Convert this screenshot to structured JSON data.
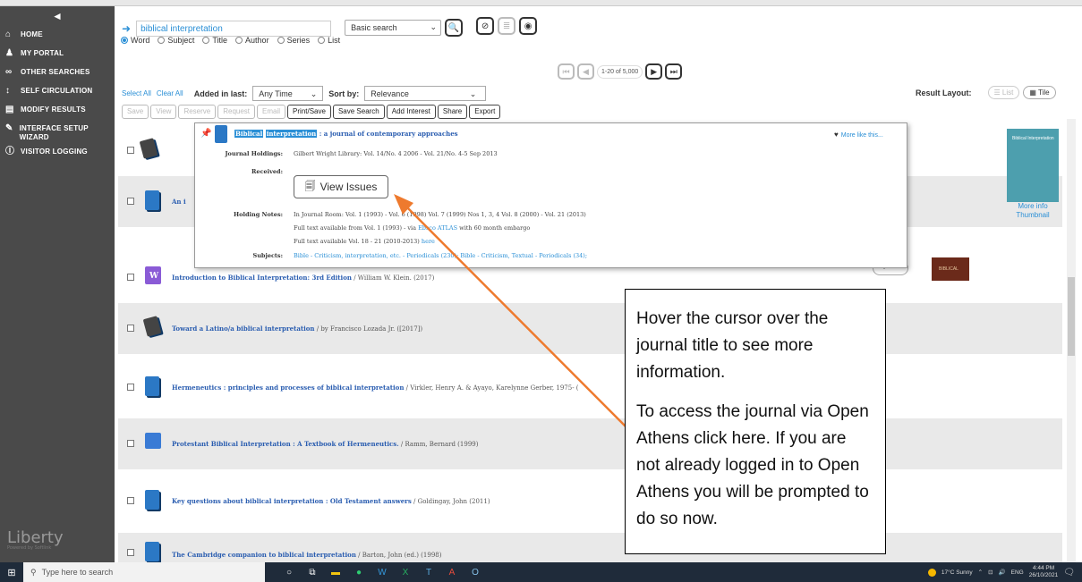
{
  "sidebar": {
    "collapse": "◄",
    "items": [
      {
        "icon": "home-icon",
        "glyph": "⌂",
        "label": "HOME"
      },
      {
        "icon": "user-icon",
        "glyph": "♟",
        "label": "MY PORTAL"
      },
      {
        "icon": "binoculars-icon",
        "glyph": "∞",
        "label": "OTHER SEARCHES"
      },
      {
        "icon": "circulation-icon",
        "glyph": "↕",
        "label": "SELF CIRCULATION"
      },
      {
        "icon": "modify-icon",
        "glyph": "▤",
        "label": "MODIFY RESULTS"
      },
      {
        "icon": "wizard-icon",
        "glyph": "✎",
        "label": "INTERFACE SETUP WIZARD"
      },
      {
        "icon": "info-icon",
        "glyph": "ⓘ",
        "label": "VISITOR LOGGING"
      }
    ],
    "logo": "Liberty",
    "logo_sub": "Powered by Softlink"
  },
  "search": {
    "query": "biblical interpretation",
    "type": "Basic search",
    "modes": [
      "Word",
      "Subject",
      "Title",
      "Author",
      "Series",
      "List"
    ],
    "selected_mode": "Word"
  },
  "pager": {
    "count": "1-20 of 5,000"
  },
  "filters": {
    "select_all": "Select All",
    "clear_all": "Clear All",
    "added_label": "Added in last:",
    "added_value": "Any Time",
    "sort_label": "Sort by:",
    "sort_value": "Relevance",
    "layout_label": "Result Layout:",
    "layout_list": "List",
    "layout_tile": "Tile"
  },
  "actions": [
    "Save",
    "View",
    "Reserve",
    "Request",
    "Email",
    "Print/Save",
    "Save Search",
    "Add Interest",
    "Share",
    "Export"
  ],
  "hover": {
    "title_hl1": "Biblical",
    "title_hl2": "interpretation",
    "title_rest": ": a journal of contemporary approaches",
    "more_like": "More like this...",
    "holdings_k": "Journal Holdings:",
    "holdings_v": "Gilbert Wright Library:  Vol. 14/No. 4 2006 - Vol. 21/No. 4-5 Sep 2013",
    "received_k": "Received:",
    "view_issues": "View Issues",
    "notes_k": "Holding Notes:",
    "notes_1": "In Journal Room: Vol. 1 (1993) - Vol. 6 (1998) Vol. 7 (1999) Nos 1, 3, 4 Vol. 8 (2000) - Vol. 21 (2013)",
    "notes_2a": "Full text available from Vol. 1 (1993) - via",
    "notes_2b": "Ebsco ATLAS",
    "notes_2c": "with 60 month embargo",
    "notes_3a": "Full text available Vol. 18 - 21 (2010-2013)",
    "notes_3b": "here",
    "subjects_k": "Subjects:",
    "subjects_v": "Bible - Criticism, interpretation, etc. - Periodicals  (230); Bible - Criticism, Textual - Periodicals  (34);"
  },
  "cover": {
    "text": "Biblical Interpretation",
    "more_info": "More info",
    "thumbnail": "Thumbnail"
  },
  "results": [
    {
      "title": "",
      "author": ""
    },
    {
      "title": "An i",
      "author": ""
    },
    {
      "title": "Introduction to Biblical Interpretation: 3rd Edition",
      "author": " / William W. Klein.  (2017)"
    },
    {
      "title": "Toward a Latino/a biblical interpretation",
      "author": " / by Francisco Lozada Jr.  ([2017])"
    },
    {
      "title": "Hermeneutics : principles and processes of biblical interpretation",
      "author": " / Virkler, Henry A.  &  Ayayo, Karelynne Gerber, 1975-  ("
    },
    {
      "title": "Protestant Biblical Interpretation : A Textbook of Hermeneutics.",
      "author": " / Ramm, Bernard  (1999)"
    },
    {
      "title": "Key questions about biblical interpretation : Old Testament answers",
      "author": " / Goldingay, John  (2011)"
    },
    {
      "title": "The Cambridge companion to biblical interpretation",
      "author": " / Barton, John (ed.)  (1998)"
    }
  ],
  "google_preview": "Google Preview",
  "book_label": "BIBLICAL",
  "callout": {
    "p1": "Hover the cursor over the journal title to see more information.",
    "p2": "To access the journal via Open Athens click here. If you are not already logged in to Open Athens you will be prompted to do so now."
  },
  "taskbar": {
    "search_placeholder": "Type here to search",
    "weather": "17°C  Sunny",
    "lang": "ENG",
    "time": "4:44 PM",
    "date": "26/10/2021"
  }
}
